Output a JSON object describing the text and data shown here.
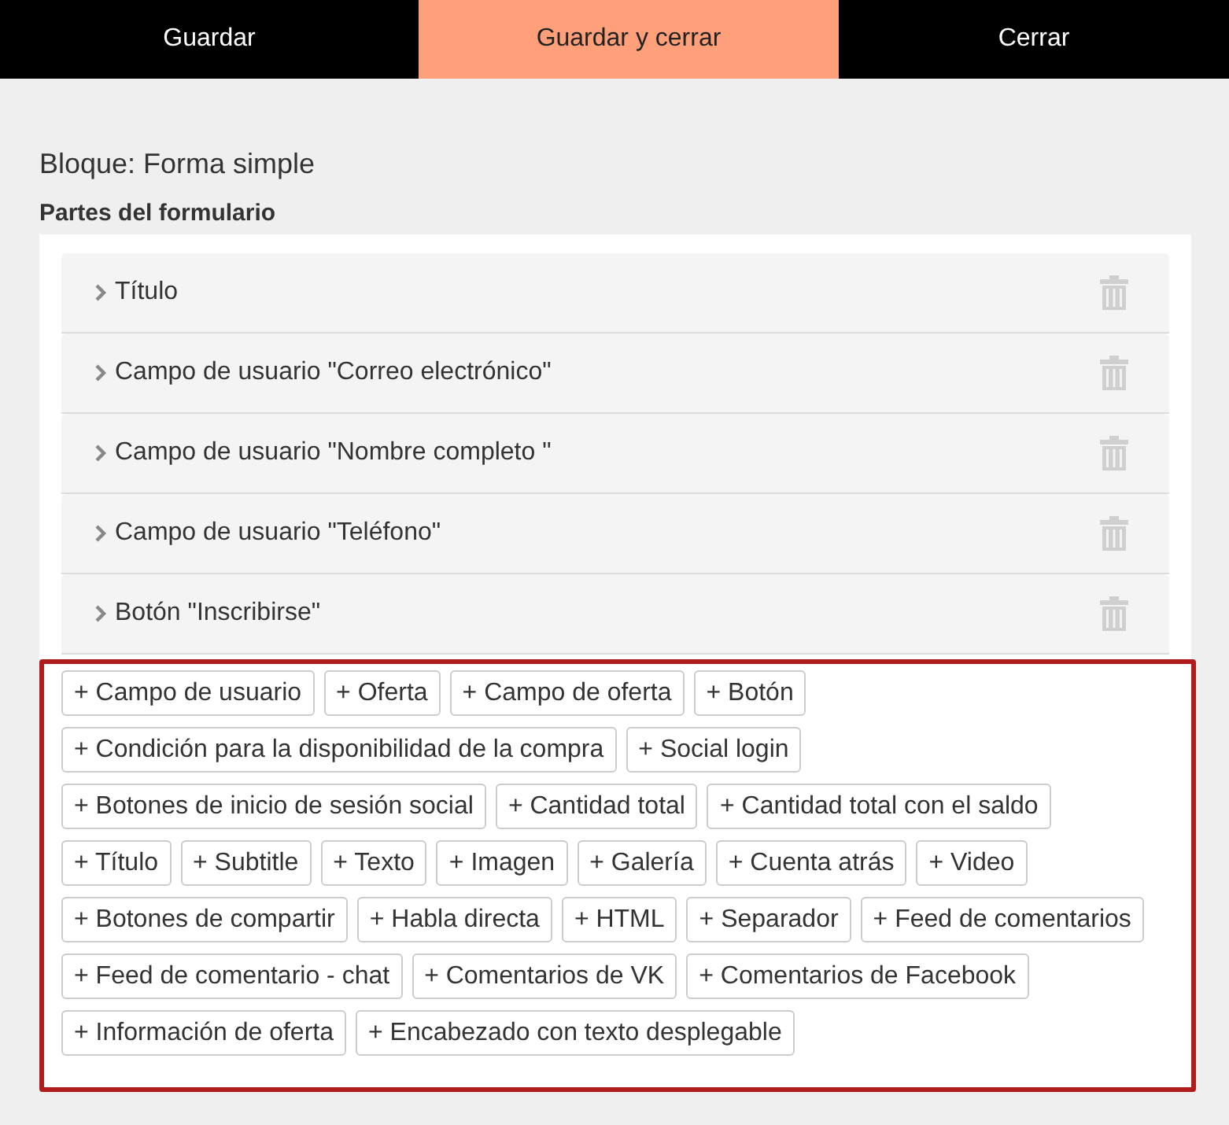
{
  "toolbar": [
    {
      "label": "Guardar",
      "selected": false
    },
    {
      "label": "Guardar y cerrar",
      "selected": true
    },
    {
      "label": "Cerrar",
      "selected": false
    }
  ],
  "block_title": "Bloque: Forma simple",
  "section_title": "Partes del formulario",
  "parts": [
    {
      "label": "Título"
    },
    {
      "label": "Campo de usuario \"Correo electrónico\""
    },
    {
      "label": "Campo de usuario \"Nombre completo \""
    },
    {
      "label": "Campo de usuario \"Teléfono\""
    },
    {
      "label": "Botón \"Inscribirse\""
    }
  ],
  "add_buttons": [
    [
      "+ Campo de usuario",
      "+ Oferta",
      "+ Campo de oferta",
      "+ Botón"
    ],
    [
      "+ Condición para la disponibilidad de la compra",
      "+ Social login"
    ],
    [
      "+ Botones de inicio de sesión social",
      "+ Cantidad total",
      "+ Cantidad total con el saldo"
    ],
    [
      "+ Título",
      "+ Subtitle",
      "+ Texto",
      "+ Imagen",
      "+ Galería",
      "+ Cuenta atrás",
      "+ Video"
    ],
    [
      "+ Botones de compartir",
      "+ Habla directa",
      "+ HTML",
      "+ Separador",
      "+ Feed de comentarios"
    ],
    [
      "+ Feed de comentario - chat",
      "+ Comentarios de VK",
      "+ Comentarios de Facebook"
    ],
    [
      "+ Información de oferta",
      "+ Encabezado con texto desplegable"
    ]
  ]
}
